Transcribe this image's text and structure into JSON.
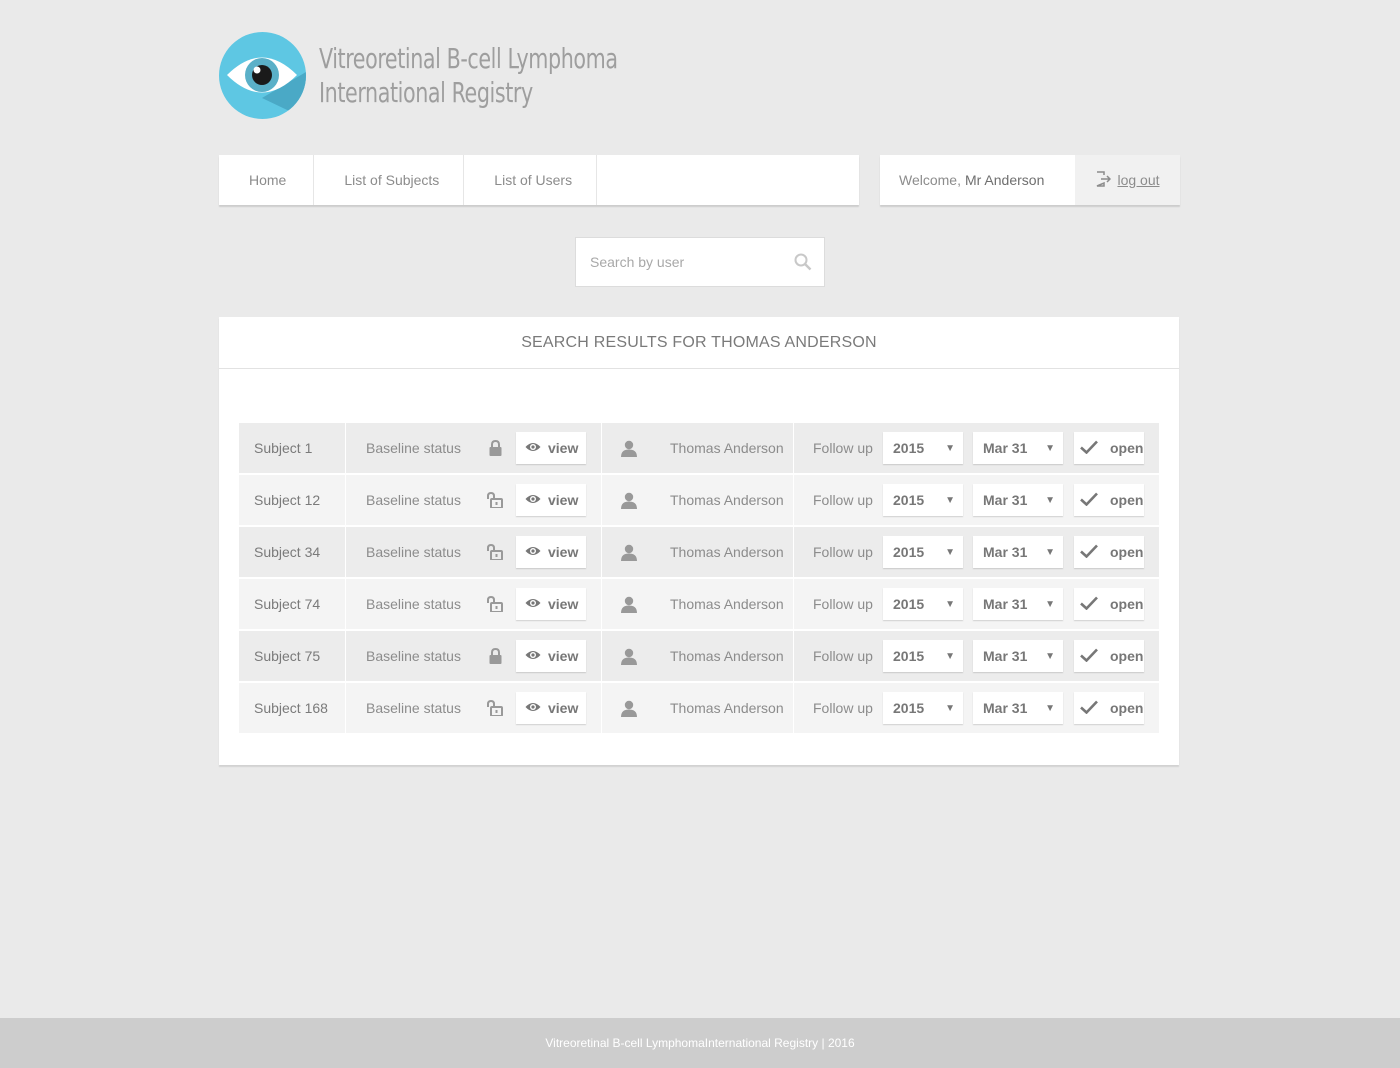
{
  "site": {
    "title_line1": "Vitreoretinal B-cell Lymphoma",
    "title_line2": "International Registry"
  },
  "nav": {
    "items": [
      {
        "label": "Home"
      },
      {
        "label": "List of Subjects"
      },
      {
        "label": "List of Users"
      }
    ]
  },
  "user": {
    "welcome_prefix": "Welcome,",
    "name": "Mr Anderson",
    "logout_label": "log out"
  },
  "search": {
    "placeholder": "Search by user"
  },
  "results": {
    "title": "SEARCH RESULTS FOR THOMAS ANDERSON",
    "rows": [
      {
        "subject": "Subject 1",
        "baseline_label": "Baseline status",
        "locked": true,
        "view_label": "view",
        "user": "Thomas Anderson",
        "followup_label": "Follow up",
        "year": "2015",
        "date": "Mar 31",
        "open_label": "open"
      },
      {
        "subject": "Subject 12",
        "baseline_label": "Baseline status",
        "locked": false,
        "view_label": "view",
        "user": "Thomas Anderson",
        "followup_label": "Follow up",
        "year": "2015",
        "date": "Mar 31",
        "open_label": "open"
      },
      {
        "subject": "Subject 34",
        "baseline_label": "Baseline status",
        "locked": false,
        "view_label": "view",
        "user": "Thomas Anderson",
        "followup_label": "Follow up",
        "year": "2015",
        "date": "Mar 31",
        "open_label": "open"
      },
      {
        "subject": "Subject 74",
        "baseline_label": "Baseline status",
        "locked": false,
        "view_label": "view",
        "user": "Thomas Anderson",
        "followup_label": "Follow up",
        "year": "2015",
        "date": "Mar 31",
        "open_label": "open"
      },
      {
        "subject": "Subject 75",
        "baseline_label": "Baseline status",
        "locked": true,
        "view_label": "view",
        "user": "Thomas Anderson",
        "followup_label": "Follow up",
        "year": "2015",
        "date": "Mar 31",
        "open_label": "open"
      },
      {
        "subject": "Subject 168",
        "baseline_label": "Baseline status",
        "locked": false,
        "view_label": "view",
        "user": "Thomas Anderson",
        "followup_label": "Follow up",
        "year": "2015",
        "date": "Mar 31",
        "open_label": "open"
      }
    ]
  },
  "footer": {
    "text": "Vitreoretinal B-cell LymphomaInternational Registry | 2016"
  },
  "colors": {
    "background": "#eaeaea",
    "logo_blue": "#5ec7e3",
    "footer": "#cdcdcd"
  },
  "icons": {
    "logo": "eye-logo",
    "logout": "logout-icon",
    "search": "search-icon",
    "locked": "lock-closed-icon",
    "unlocked": "lock-open-icon",
    "view": "eye-icon",
    "user": "person-icon",
    "open": "checkmark-icon",
    "dropdown": "caret-down-icon"
  }
}
